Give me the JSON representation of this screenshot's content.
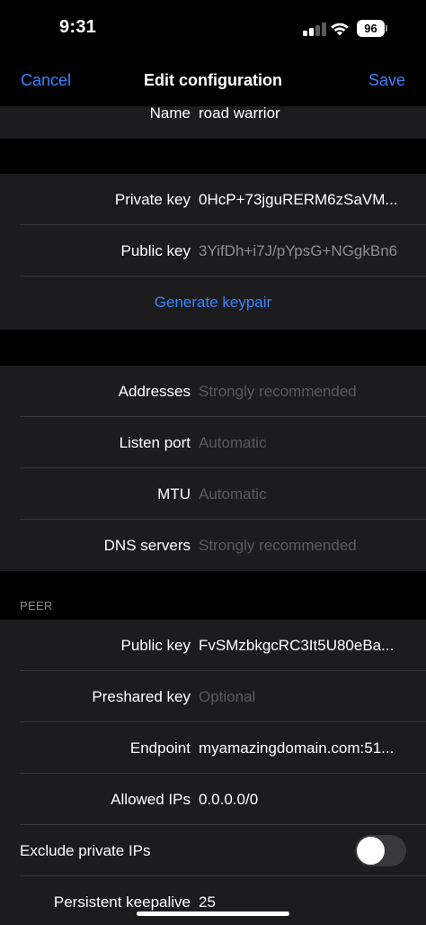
{
  "status_bar": {
    "time": "9:31",
    "battery": "96"
  },
  "nav": {
    "cancel": "Cancel",
    "title": "Edit configuration",
    "save": "Save"
  },
  "interface": {
    "name_label": "Name",
    "name_value": "road warrior",
    "private_key_label": "Private key",
    "private_key_value": "0HcP+73jguRERM6zSaVM...",
    "public_key_label": "Public key",
    "public_key_value": "3YifDh+i7J/pYpsG+NGgkBn6",
    "generate_keypair": "Generate keypair",
    "addresses_label": "Addresses",
    "addresses_placeholder": "Strongly recommended",
    "listen_port_label": "Listen port",
    "listen_port_placeholder": "Automatic",
    "mtu_label": "MTU",
    "mtu_placeholder": "Automatic",
    "dns_label": "DNS servers",
    "dns_placeholder": "Strongly recommended"
  },
  "peer": {
    "header": "PEER",
    "public_key_label": "Public key",
    "public_key_value": "FvSMzbkgcRC3It5U80eBa...",
    "preshared_key_label": "Preshared key",
    "preshared_key_placeholder": "Optional",
    "endpoint_label": "Endpoint",
    "endpoint_value": "myamazingdomain.com:51...",
    "allowed_ips_label": "Allowed IPs",
    "allowed_ips_value": "0.0.0.0/0",
    "exclude_private_label": "Exclude private IPs",
    "exclude_private_on": false,
    "keepalive_label": "Persistent keepalive",
    "keepalive_value": "25"
  },
  "colors": {
    "accent": "#3a85ff",
    "cell_background": "#1c1c1e",
    "background": "#000000"
  }
}
